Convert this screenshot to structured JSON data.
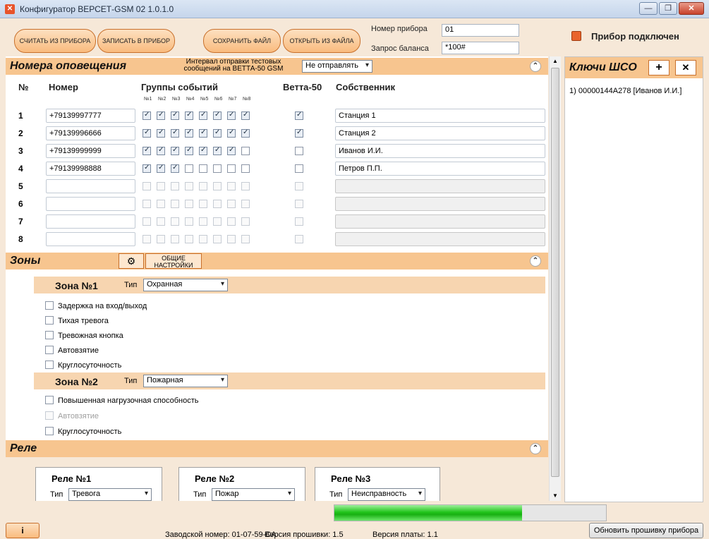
{
  "window": {
    "title": "Конфигуратор ВЕРСЕТ-GSM 02 1.0.1.0",
    "minimize": "—",
    "maximize": "❐",
    "close": "✕"
  },
  "toolbar": {
    "read_btn": "СЧИТАТЬ ИЗ ПРИБОРА",
    "write_btn": "ЗАПИСАТЬ В ПРИБОР",
    "save_file_btn": "СОХРАНИТЬ ФАЙЛ",
    "open_file_btn": "ОТКРЫТЬ ИЗ ФАЙЛА",
    "device_number_label": "Номер прибора",
    "device_number_value": "01",
    "balance_label": "Запрос баланса",
    "balance_value": "*100#",
    "connected_text": "Прибор подключен"
  },
  "notify": {
    "title": "Номера оповещения",
    "interval_label": "Интервал отправки тестовых сообщений на ВЕТТА-50 GSM",
    "interval_value": "Не отправлять",
    "col_num": "№",
    "col_number": "Номер",
    "col_groups": "Группы событий",
    "col_vetta": "Ветта-50",
    "col_owner": "Собственник",
    "group_labels": [
      "№1",
      "№2",
      "№3",
      "№4",
      "№5",
      "№6",
      "№7",
      "№8"
    ],
    "rows": [
      {
        "n": "1",
        "phone": "+79139997777",
        "owner": "Станция 1"
      },
      {
        "n": "2",
        "phone": "+79139996666",
        "owner": "Станция 2"
      },
      {
        "n": "3",
        "phone": "+79139999999",
        "owner": "Иванов И.И."
      },
      {
        "n": "4",
        "phone": "+79139998888",
        "owner": "Петров П.П."
      },
      {
        "n": "5",
        "phone": "",
        "owner": ""
      },
      {
        "n": "6",
        "phone": "",
        "owner": ""
      },
      {
        "n": "7",
        "phone": "",
        "owner": ""
      },
      {
        "n": "8",
        "phone": "",
        "owner": ""
      }
    ]
  },
  "zones": {
    "title": "Зоны",
    "general_btn": "ОБЩИЕ НАСТРОЙКИ",
    "type_label": "Тип",
    "zone1": {
      "title": "Зона №1",
      "type": "Охранная",
      "options": [
        "Задержка на вход/выход",
        "Тихая тревога",
        "Тревожная кнопка",
        "Автовзятие",
        "Круглосуточность"
      ]
    },
    "zone2": {
      "title": "Зона №2",
      "type": "Пожарная",
      "options": [
        "Повышенная нагрузочная способность",
        "Автовзятие",
        "Круглосуточность"
      ]
    }
  },
  "relays": {
    "title": "Реле",
    "type_label": "Тип",
    "items": [
      {
        "title": "Реле №1",
        "type": "Тревога"
      },
      {
        "title": "Реле №2",
        "type": "Пожар"
      },
      {
        "title": "Реле №3",
        "type": "Неисправность"
      }
    ]
  },
  "keys": {
    "title": "Ключи ШСО",
    "add": "+",
    "remove": "✕",
    "items": [
      "1) 00000144A278 [Иванов И.И.]"
    ]
  },
  "status": {
    "info_btn": "i",
    "serial": "Заводской номер: 01-07-59-CA",
    "firmware": "Версия прошивки: 1.5",
    "board": "Версия платы: 1.1",
    "progress": 0.69,
    "update_fw_btn": "Обновить прошивку прибора"
  },
  "colors": {
    "accent": "#f7c58f",
    "led": "#e9642c",
    "progress": "#22c51c"
  }
}
